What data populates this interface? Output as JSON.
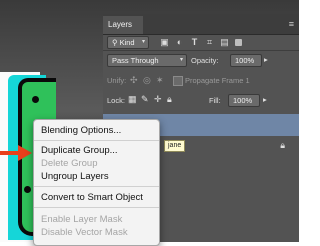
{
  "panel": {
    "tab_label": "Layers",
    "menu_glyph": "≡",
    "filter": {
      "label": "Kind",
      "arrow": "▾"
    },
    "blend_mode": {
      "value": "Pass Through",
      "arrow": "▾"
    },
    "opacity": {
      "label": "Opacity:",
      "value": "100%",
      "arrow": "▸"
    },
    "unify": {
      "label": "Unify:",
      "propagate_label": "Propagate Frame 1"
    },
    "lock": {
      "label": "Lock:"
    },
    "fill": {
      "label": "Fill:",
      "value": "100%",
      "arrow": "▸"
    },
    "tooltip": "jane"
  },
  "context_menu": {
    "items": [
      {
        "label": "Blending Options...",
        "enabled": true
      },
      {
        "label": "Duplicate Group...",
        "enabled": true
      },
      {
        "label": "Delete Group",
        "enabled": false
      },
      {
        "label": "Ungroup Layers",
        "enabled": true
      },
      {
        "label": "Convert to Smart Object",
        "enabled": true
      },
      {
        "label": "Enable Layer Mask",
        "enabled": false
      },
      {
        "label": "Disable Vector Mask",
        "enabled": false
      }
    ]
  },
  "colors": {
    "arrow": "#e8401c",
    "panel_bg": "#535353",
    "selected_layer": "#6f86a6"
  }
}
